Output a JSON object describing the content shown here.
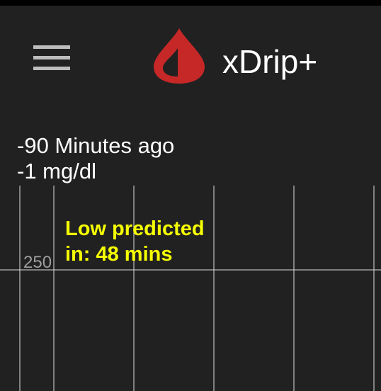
{
  "app": {
    "title": "xDrip+",
    "logo_icon": "blood-drop-icon",
    "menu_icon": "hamburger-menu-icon",
    "brand_color": "#c62828"
  },
  "reading": {
    "time_ago": "-90 Minutes ago",
    "delta": "-1 mg/dl"
  },
  "graph": {
    "y_ticks": [
      "250"
    ],
    "prediction_line1": "Low predicted",
    "prediction_line2": "in: 48 mins",
    "prediction_color": "#f5ff00",
    "grid_color": "#e0e0e0"
  }
}
